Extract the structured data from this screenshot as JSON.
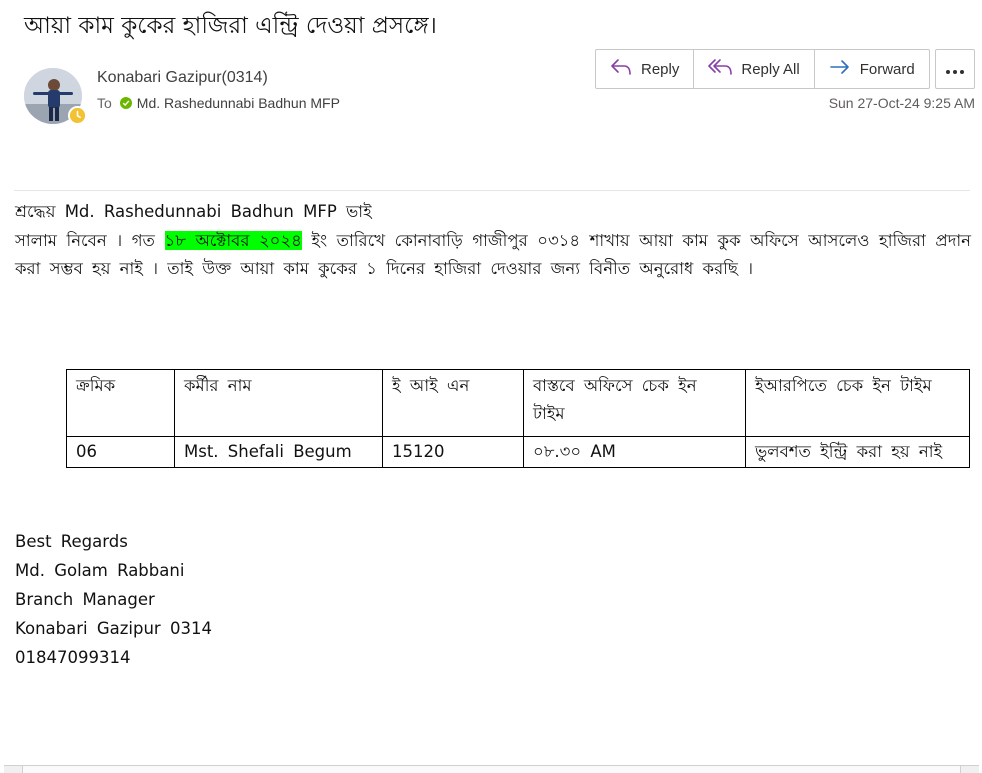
{
  "email": {
    "subject": "আয়া কাম কুকের হাজিরা এন্ট্রি দেওয়া প্রসঙ্গে।",
    "sender": "Konabari Gazipur(0314)",
    "to_label": "To",
    "recipient": "Md. Rashedunnabi Badhun MFP",
    "date": "Sun 27-Oct-24 9:25 AM"
  },
  "actions": {
    "reply": "Reply",
    "reply_all": "Reply All",
    "forward": "Forward"
  },
  "body": {
    "greeting": "শ্রদ্ধেয় Md. Rashedunnabi Badhun MFP ভাই",
    "p_start": "সালাম নিবেন । গত ",
    "p_highlight": "১৮ অক্টোবর ২০২৪",
    "p_end": " ইং তারিখে কোনাবাড়ি গাজীপুর ০৩১৪ শাখায় আয়া কাম কুক অফিসে আসলেও হাজিরা প্রদান করা সম্ভব হয় নাই । তাই উক্ত আয়া কাম কুকের ১ দিনের হাজিরা দেওয়ার জন্য বিনীত অনুরোধ করছি ।"
  },
  "table": {
    "headers": [
      "ক্রমিক",
      "কর্মীর নাম",
      "ই আই এন",
      "বাস্তবে অফিসে চেক ইন টাইম",
      "ইআরপিতে চেক ইন টাইম"
    ],
    "rows": [
      [
        "06",
        "Mst. Shefali Begum",
        "15120",
        "০৮.৩০ AM",
        "ভুলবশত ইন্ট্রি করা হয় নাই"
      ]
    ]
  },
  "signature": {
    "closing": "Best Regards",
    "name": "Md. Golam Rabbani",
    "title": "Branch Manager",
    "branch": "Konabari Gazipur 0314",
    "phone": "01847099314"
  },
  "colors": {
    "highlight": "#00ff00",
    "presence_away": "#f2c233",
    "verified": "#6bb700",
    "reply_icon": "#8a3fa8",
    "forward_icon": "#2f6fbf"
  }
}
